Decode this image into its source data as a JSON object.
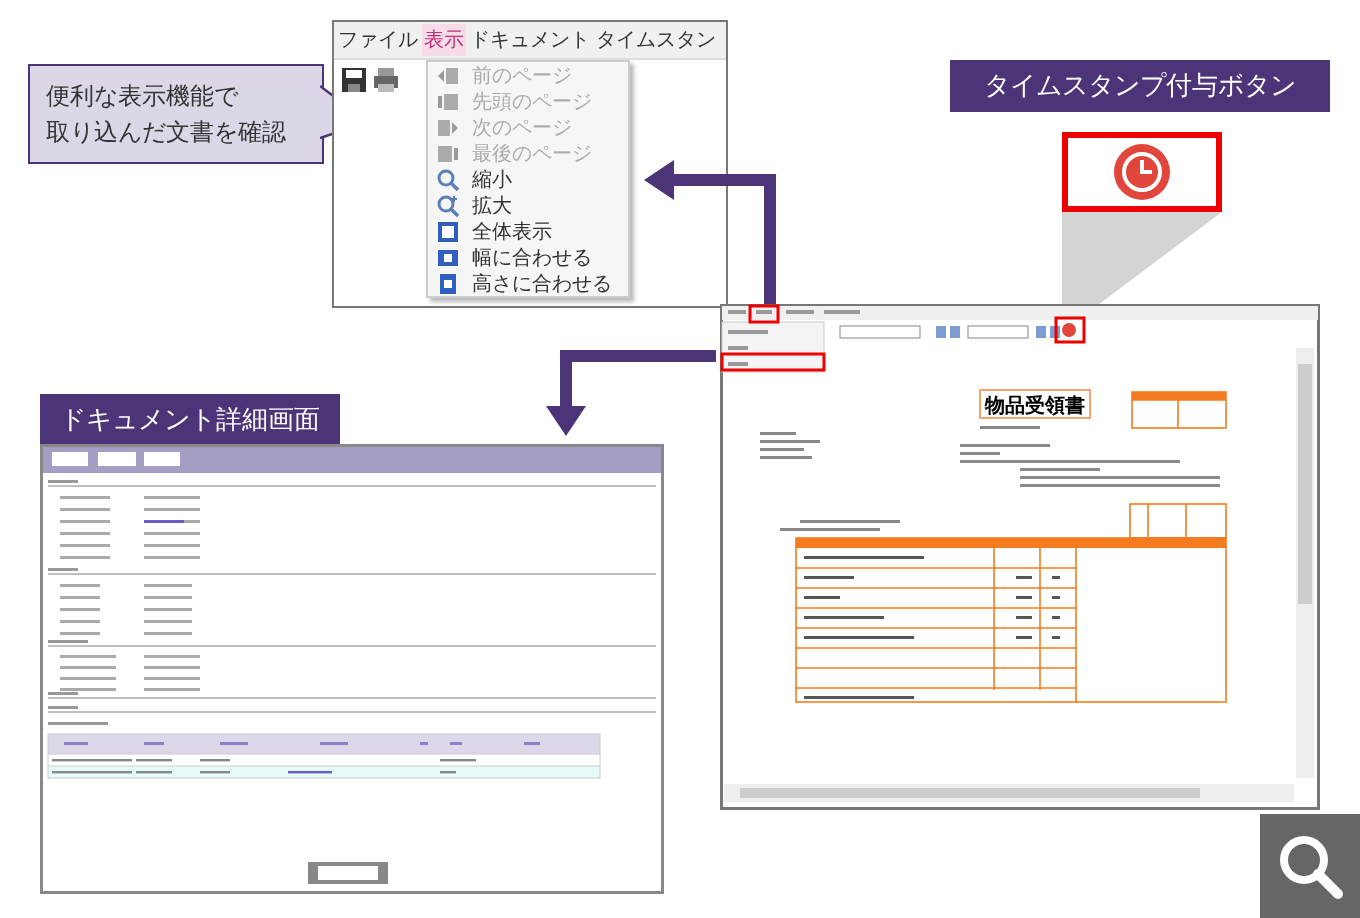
{
  "callout": {
    "lines": [
      "便利な表示機能で",
      "取り込んだ文書を確認"
    ]
  },
  "menu_screenshot": {
    "menubar": [
      {
        "label": "ファイル",
        "selected": false
      },
      {
        "label": "表示",
        "selected": true
      },
      {
        "label": "ドキュメント",
        "selected": false
      },
      {
        "label": "タイムスタン",
        "selected": false
      }
    ],
    "items": [
      {
        "label": "前のページ",
        "kind": "prev",
        "disabled": true
      },
      {
        "label": "先頭のページ",
        "kind": "first",
        "disabled": true
      },
      {
        "label": "次のページ",
        "kind": "next",
        "disabled": true
      },
      {
        "label": "最後のページ",
        "kind": "last",
        "disabled": true
      },
      {
        "label": "縮小",
        "kind": "zoom-out",
        "disabled": false
      },
      {
        "label": "拡大",
        "kind": "zoom-in",
        "disabled": false
      },
      {
        "label": "全体表示",
        "kind": "fit-all",
        "disabled": false
      },
      {
        "label": "幅に合わせる",
        "kind": "fit-width",
        "disabled": false
      },
      {
        "label": "高さに合わせる",
        "kind": "fit-height",
        "disabled": false
      }
    ]
  },
  "timestamp_label": "タイムスタンプ付与ボタン",
  "viewer": {
    "document_title": "物品受領書"
  },
  "detail_label": "ドキュメント詳細画面"
}
